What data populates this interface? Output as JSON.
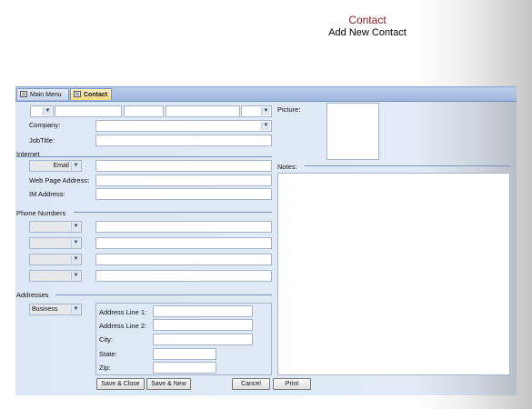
{
  "header": {
    "title": "Contact",
    "subtitle": "Add New Contact"
  },
  "tabs": [
    {
      "label": "Main Menu"
    },
    {
      "label": "Contact"
    }
  ],
  "form": {
    "company_label": "Company:",
    "jobtitle_label": "JobTitle:",
    "picture_label": "Picture:",
    "internet_section": "Internet",
    "email_type": "Email",
    "webpage_label": "Web Page Address:",
    "im_label": "IM Address:",
    "notes_label": "Notes:",
    "phone_section": "Phone Numbers",
    "addresses_section": "Addresses",
    "address_type": "Business",
    "address_line1_label": "Address Line 1:",
    "address_line2_label": "Address Line 2:",
    "city_label": "City:",
    "state_label": "State:",
    "zip_label": "Zip:"
  },
  "buttons": {
    "save_close": "Save & Close",
    "save_new": "Save & New",
    "cancel": "Cancel",
    "print": "Print"
  },
  "icons": {
    "dropdown": "chevron-down-icon",
    "form": "form-icon"
  },
  "colors": {
    "title": "#8a1b1b",
    "tab_active": "#f7d87c",
    "form_bg": "#dde8f6"
  }
}
